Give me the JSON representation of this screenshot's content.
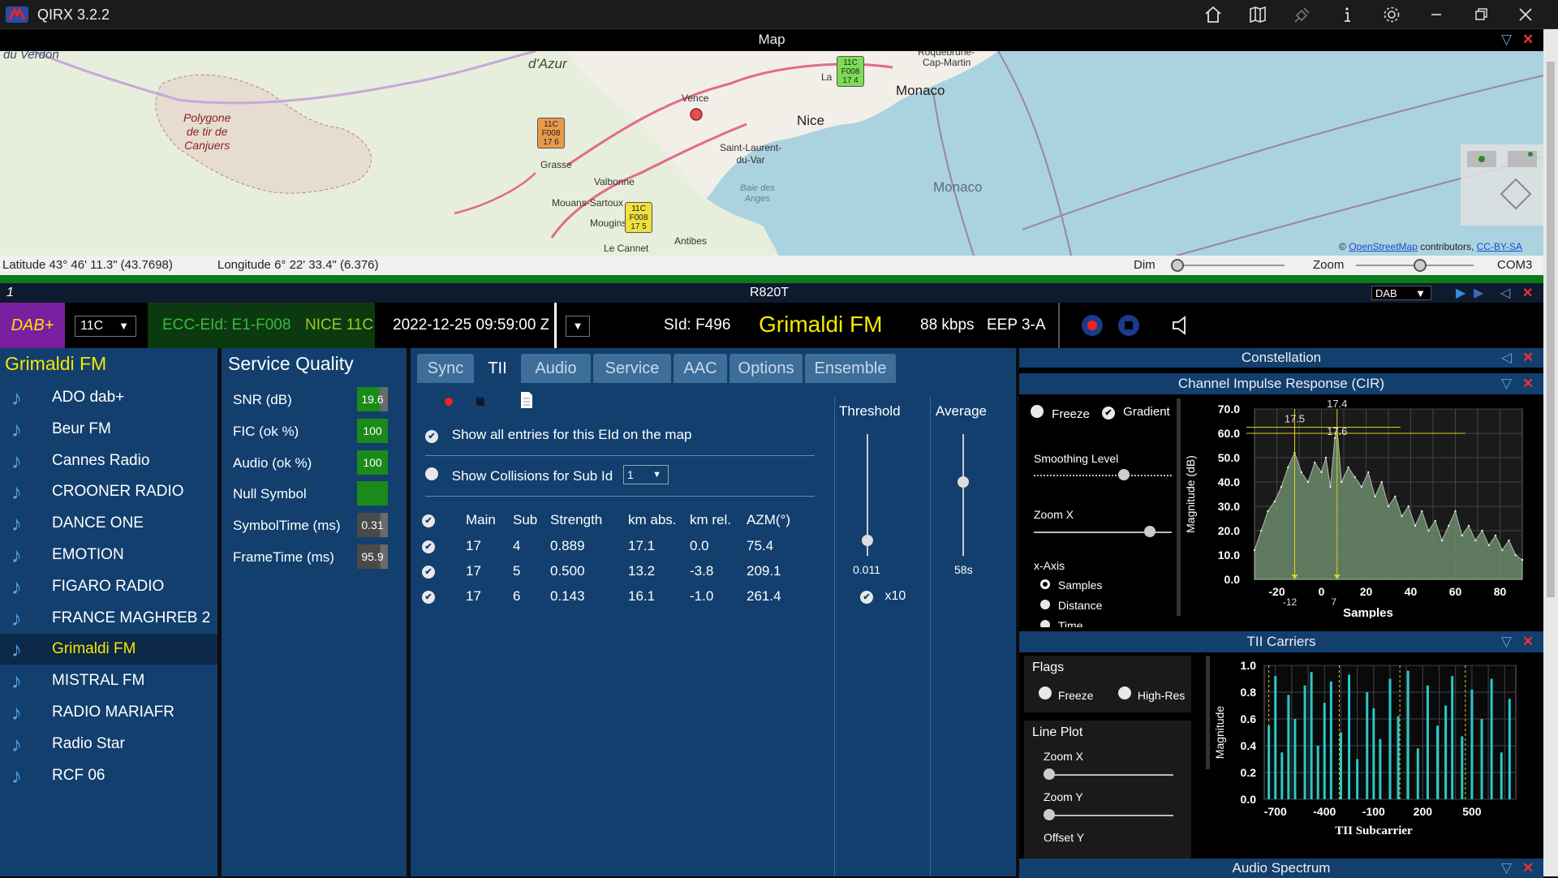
{
  "app": {
    "title": "QIRX 3.2.2"
  },
  "titlebar_icons": [
    "home-icon",
    "map-icon",
    "satellite-icon",
    "info-icon",
    "gear-icon",
    "minimize-icon",
    "maximize-icon",
    "close-icon"
  ],
  "map": {
    "header": "Map",
    "labels": {
      "azur": "d'Azur",
      "polygone": "Polygone\nde tir de\nCanjuers",
      "vence": "Vence",
      "nice": "Nice",
      "monaco_city": "Monaco",
      "monaco_sea": "Monaco",
      "cap": "Cap-Martin",
      "roquebrune": "Roquebrune-",
      "st_laurent": "Saint-Laurent-\ndu-Var",
      "baie": "Baie des\nAnges",
      "valbonne": "Valbonne",
      "mouans": "Mouans-Sartoux",
      "mougins": "Mougins",
      "antibes": "Antibes",
      "le_cannet": "Le Cannet",
      "grasse": "Grasse",
      "verdon": "du Verdon",
      "la": "La"
    },
    "markers": [
      {
        "text": "11C\nF008\n17 6",
        "color": "#e89a4a"
      },
      {
        "text": "11C\nF008\n17 4",
        "color": "#7ddc55"
      },
      {
        "text": "11C\nF008\n17 5",
        "color": "#f0e040"
      }
    ],
    "attribution": {
      "prefix": "©",
      "osm": "OpenStreetMap",
      "mid": "contributors,",
      "license": "CC-BY-SA"
    },
    "status": {
      "latitude": "Latitude 43° 46' 11.3\" (43.7698)",
      "longitude": "Longitude 6° 22' 33.4\" (6.376)",
      "dim_label": "Dim",
      "zoom_label": "Zoom",
      "port": "COM3",
      "dim_level": 0.0,
      "zoom_level": 0.55
    }
  },
  "device": {
    "index": "1",
    "name": "R820T",
    "mode": "DAB"
  },
  "info": {
    "dab_label": "DAB+",
    "channel": "11C",
    "ecc": "ECC-EId: E1-F008",
    "ensemble": "NICE 11C",
    "datetime": "2022-12-25  09:59:00 Z",
    "sid": "SId: F496",
    "service": "Grimaldi FM",
    "bitrate": "88 kbps",
    "eep": "EEP 3-A"
  },
  "service_list": {
    "title": "Grimaldi FM",
    "items": [
      "ADO dab+",
      "Beur FM",
      "Cannes Radio",
      "CROONER RADIO",
      "DANCE ONE",
      "EMOTION",
      "FIGARO RADIO",
      "FRANCE MAGHREB 2",
      "Grimaldi FM",
      "MISTRAL FM",
      "RADIO MARIAFR",
      "Radio Star",
      "RCF 06"
    ],
    "selected": "Grimaldi FM"
  },
  "service_quality": {
    "title": "Service Quality",
    "rows": [
      {
        "label": "SNR (dB)",
        "value": "19.6"
      },
      {
        "label": "FIC (ok %)",
        "value": "100"
      },
      {
        "label": "Audio (ok %)",
        "value": "100"
      },
      {
        "label": "Null Symbol",
        "value": ""
      },
      {
        "label": "SymbolTime (ms)",
        "value": "0.31"
      },
      {
        "label": "FrameTime (ms)",
        "value": "95.9"
      }
    ]
  },
  "tabs": [
    "Sync",
    "TII",
    "Audio",
    "Service",
    "AAC",
    "Options",
    "Ensemble"
  ],
  "active_tab": "TII",
  "tii": {
    "show_all": "Show all entries for this EId on the map",
    "show_collisions": "Show Collisions for Sub Id",
    "sub_id": "1",
    "columns": [
      "Main",
      "Sub",
      "Strength",
      "km abs.",
      "km rel.",
      "AZM(°)"
    ],
    "rows": [
      [
        "17",
        "4",
        "0.889",
        "17.1",
        "0.0",
        "75.4"
      ],
      [
        "17",
        "5",
        "0.500",
        "13.2",
        "-3.8",
        "209.1"
      ],
      [
        "17",
        "6",
        "0.143",
        "16.1",
        "-1.0",
        "261.4"
      ]
    ],
    "threshold_label": "Threshold",
    "threshold_value": "0.011",
    "average_label": "Average",
    "average_value": "58s",
    "x10": "x10"
  },
  "constellation": {
    "header": "Constellation"
  },
  "cir": {
    "header": "Channel Impulse Response (CIR)",
    "freeze": "Freeze",
    "gradient": "Gradient",
    "smoothing": "Smoothing Level",
    "zoom_x": "Zoom X",
    "x_axis": "x-Axis",
    "opt_samples": "Samples",
    "opt_distance": "Distance",
    "opt_time": "Time",
    "chart_data": {
      "type": "area",
      "xlabel": "Samples",
      "ylabel": "Magnitude (dB)",
      "xlim": [
        -30,
        90
      ],
      "ylim": [
        0,
        70
      ],
      "xticks": [
        "-20",
        "0",
        "20",
        "40",
        "60",
        "80"
      ],
      "yticks": [
        "0.0",
        "10.0",
        "20.0",
        "30.0",
        "40.0",
        "50.0",
        "60.0",
        "70.0"
      ],
      "annotations": [
        "17.5",
        "17.4",
        "17.6",
        "-12",
        "7"
      ],
      "x": [
        -30,
        -27,
        -24,
        -21,
        -18,
        -15,
        -12,
        -9,
        -6,
        -3,
        0,
        2,
        4,
        6,
        7,
        9,
        12,
        15,
        18,
        21,
        24,
        27,
        30,
        33,
        36,
        39,
        42,
        45,
        48,
        51,
        54,
        57,
        60,
        63,
        66,
        69,
        72,
        75,
        78,
        81,
        84,
        87,
        90
      ],
      "values": [
        12,
        20,
        28,
        32,
        38,
        46,
        52,
        44,
        40,
        48,
        44,
        50,
        38,
        58,
        62,
        40,
        46,
        42,
        38,
        44,
        34,
        40,
        30,
        34,
        26,
        30,
        22,
        28,
        20,
        24,
        16,
        22,
        28,
        18,
        22,
        16,
        20,
        14,
        18,
        12,
        16,
        10,
        8
      ]
    }
  },
  "tii_carriers": {
    "header": "TII Carriers",
    "flags": "Flags",
    "freeze": "Freeze",
    "highres": "High-Res",
    "line_plot": "Line Plot",
    "zoom_x": "Zoom X",
    "zoom_y": "Zoom Y",
    "offset_y": "Offset Y",
    "chart_data": {
      "type": "bar",
      "xlabel": "TII Subcarrier",
      "ylabel": "Magnitude",
      "xlim": [
        -768,
        768
      ],
      "ylim": [
        0,
        1.0
      ],
      "xticks": [
        "-700",
        "-400",
        "-100",
        "200",
        "500"
      ],
      "yticks": [
        "0.0",
        "0.2",
        "0.4",
        "0.6",
        "0.8",
        "1.0"
      ],
      "x": [
        -740,
        -700,
        -660,
        -620,
        -580,
        -520,
        -480,
        -440,
        -400,
        -360,
        -300,
        -250,
        -200,
        -140,
        -100,
        -60,
        0,
        50,
        110,
        170,
        230,
        290,
        340,
        380,
        440,
        500,
        560,
        620,
        680,
        730
      ],
      "values": [
        0.55,
        0.92,
        0.35,
        0.78,
        0.6,
        0.85,
        0.95,
        0.4,
        0.72,
        0.88,
        0.5,
        0.93,
        0.3,
        0.8,
        0.68,
        0.45,
        0.9,
        0.62,
        0.96,
        0.38,
        0.85,
        0.55,
        0.7,
        0.92,
        0.47,
        0.82,
        0.6,
        0.9,
        0.35,
        0.75
      ]
    }
  },
  "audio_spectrum": {
    "header": "Audio Spectrum"
  },
  "colors": {
    "panel": "#123f6e",
    "accent": "#f6e800",
    "ok": "#1a8a1a",
    "close": "#e33333"
  }
}
